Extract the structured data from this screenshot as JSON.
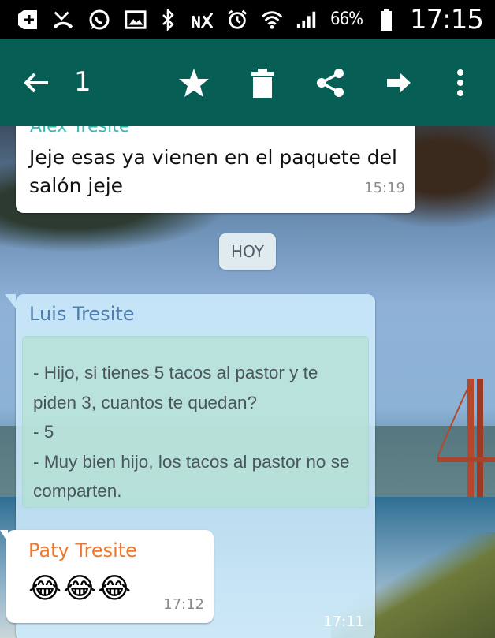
{
  "status_bar": {
    "left_icons": [
      "add-icon",
      "missed-call-icon",
      "whatsapp-icon",
      "image-icon"
    ],
    "right_icons": [
      "bluetooth-icon",
      "no-signal-icon",
      "alarm-icon",
      "wifi-icon",
      "signal-icon"
    ],
    "battery": "66%",
    "time": "17:15"
  },
  "app_bar": {
    "selected_count": "1",
    "actions": [
      "back-arrow-icon",
      "star-icon",
      "delete-icon",
      "share-icon",
      "forward-icon",
      "more-vert-icon"
    ]
  },
  "messages": [
    {
      "sender": "Alex Tresite",
      "text": "Jeje esas ya vienen en el paquete del salón jeje",
      "time": "15:19"
    },
    {
      "date_divider": "HOY"
    },
    {
      "sender": "Luis Tresite",
      "text": "- Hijo, si tienes 5 tacos al pastor y te piden 3, cuantos te quedan?\n- 5\n- Muy bien hijo, los tacos al pastor no se comparten.",
      "time": "17:11",
      "selected": true
    },
    {
      "sender": "Paty Tresite",
      "text": "😂😂😂",
      "time": "17:12"
    }
  ],
  "colors": {
    "app_bar": "#075e54",
    "status_bar": "#000000",
    "sender_alex": "#27b0a8",
    "sender_luis": "#4f7fae",
    "sender_paty": "#f0772a"
  }
}
